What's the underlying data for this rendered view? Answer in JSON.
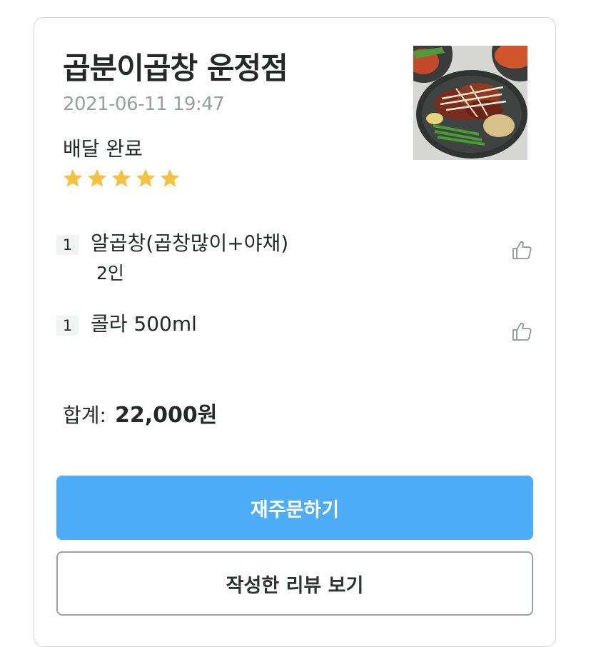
{
  "order": {
    "store_name": "곱분이곱창 운정점",
    "date": "2021-06-11 19:47",
    "status": "배달 완료",
    "rating": 5,
    "rating_max": 5,
    "star_color": "#f5c142"
  },
  "items": [
    {
      "qty": "1",
      "name": "알곱창(곱창많이+야채)",
      "option": "2인",
      "icon": "thumbs-up-icon"
    },
    {
      "qty": "1",
      "name": "콜라 500ml",
      "option": "",
      "icon": "thumbs-up-icon"
    }
  ],
  "total": {
    "label": "합계:",
    "value": "22,000원"
  },
  "buttons": {
    "reorder": "재주문하기",
    "view_review": "작성한 리뷰 보기"
  },
  "colors": {
    "primary": "#4fadf7",
    "text": "#25282b",
    "muted": "#9a9ea3"
  }
}
